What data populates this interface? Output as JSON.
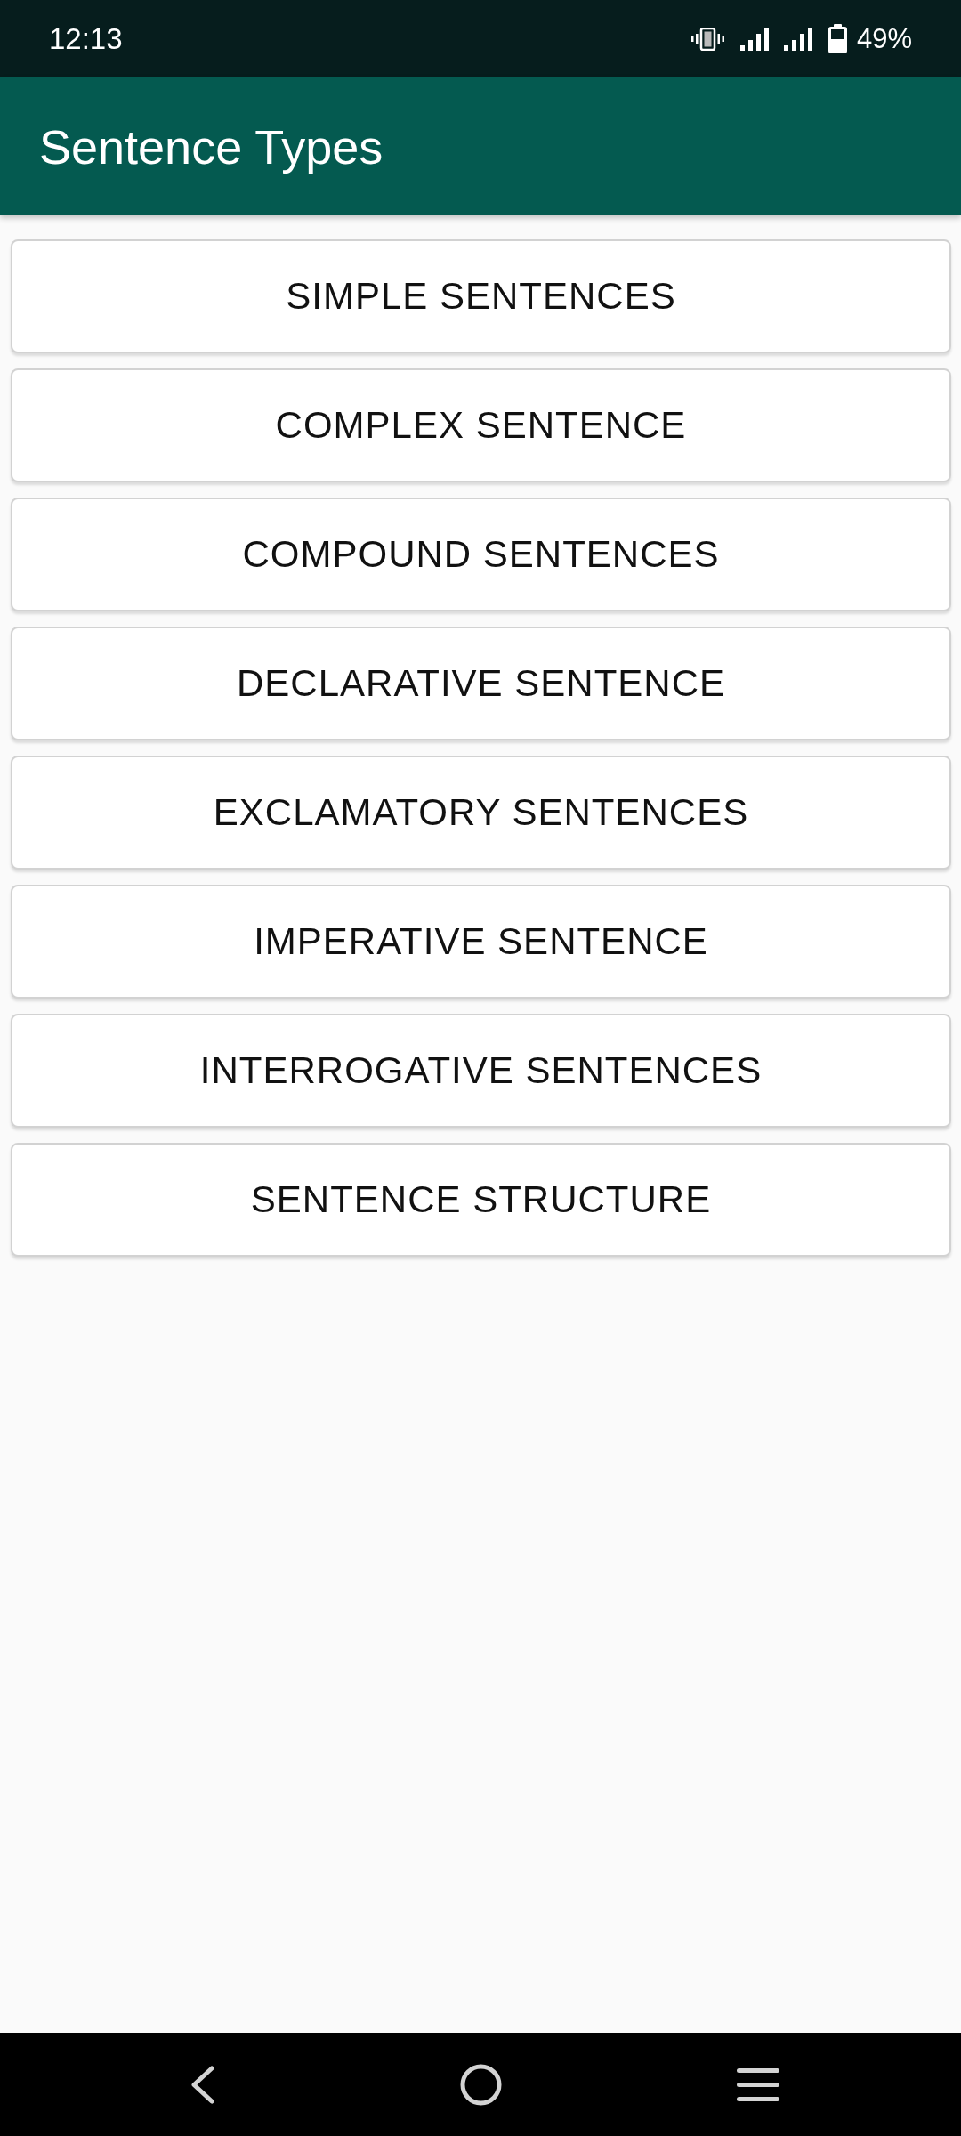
{
  "status_bar": {
    "time": "12:13",
    "battery": "49%"
  },
  "app_bar": {
    "title": "Sentence Types"
  },
  "buttons": [
    {
      "label": "SIMPLE SENTENCES"
    },
    {
      "label": "COMPLEX SENTENCE"
    },
    {
      "label": "COMPOUND SENTENCES"
    },
    {
      "label": "DECLARATIVE SENTENCE"
    },
    {
      "label": "EXCLAMATORY SENTENCES"
    },
    {
      "label": "IMPERATIVE SENTENCE"
    },
    {
      "label": "INTERROGATIVE SENTENCES"
    },
    {
      "label": "SENTENCE STRUCTURE"
    }
  ]
}
